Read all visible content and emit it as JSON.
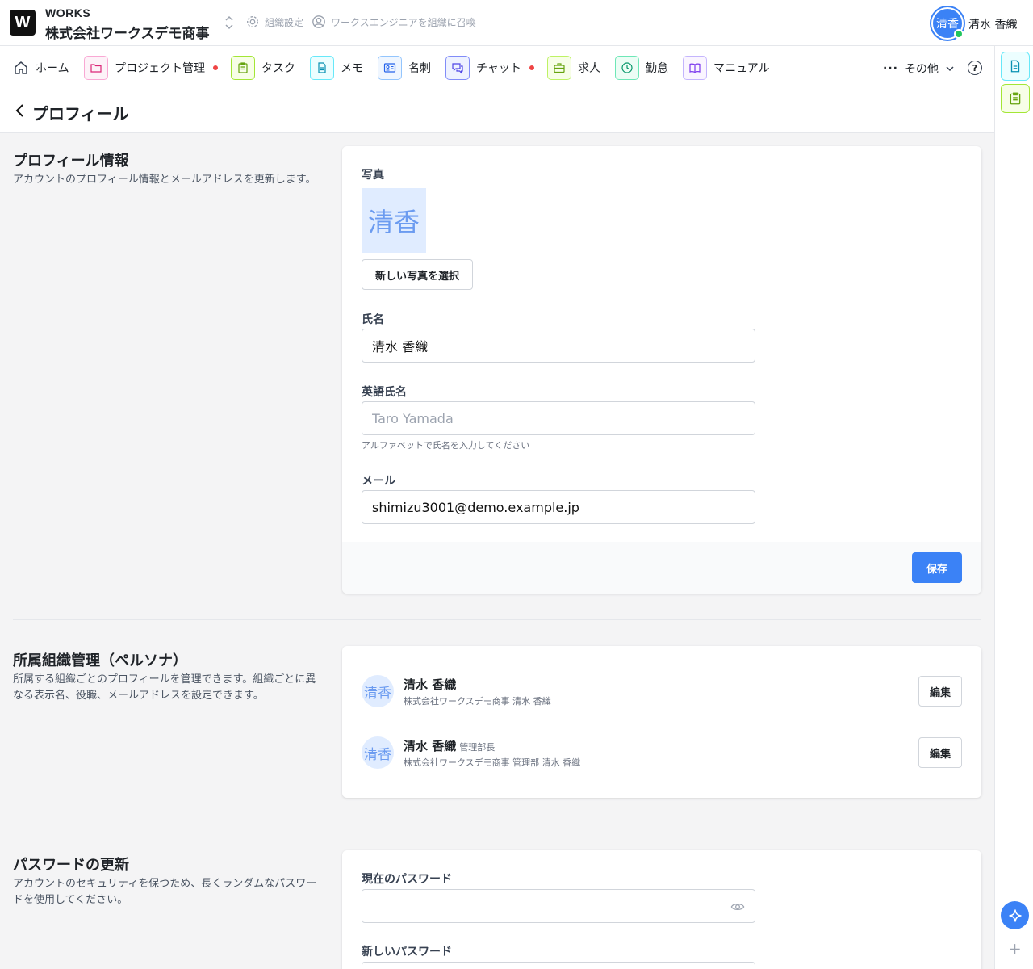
{
  "app": {
    "logo_letter": "W",
    "brand": "WORKS",
    "org_name": "株式会社ワークスデモ商事",
    "org_settings": "組織設定",
    "invite_engineer": "ワークスエンジニアを組織に召喚",
    "user_avatar_text": "清香",
    "user_name": "清水 香織"
  },
  "nav": {
    "items": [
      {
        "label": "ホーム",
        "icon": "home-icon"
      },
      {
        "label": "プロジェクト管理",
        "icon": "folder-icon",
        "badge": true
      },
      {
        "label": "タスク",
        "icon": "clipboard-icon"
      },
      {
        "label": "メモ",
        "icon": "document-icon"
      },
      {
        "label": "名刺",
        "icon": "id-card-icon"
      },
      {
        "label": "チャット",
        "icon": "chat-icon",
        "badge": true
      },
      {
        "label": "求人",
        "icon": "briefcase-icon"
      },
      {
        "label": "勤怠",
        "icon": "clock-icon"
      },
      {
        "label": "マニュアル",
        "icon": "book-icon"
      }
    ],
    "more_label": "その他",
    "help_label": "?"
  },
  "page": {
    "title": "プロフィール"
  },
  "profile_section": {
    "title": "プロフィール情報",
    "description": "アカウントのプロフィール情報とメールアドレスを更新します。",
    "photo_label": "写真",
    "photo_text": "清香",
    "select_photo_button": "新しい写真を選択",
    "name_label": "氏名",
    "name_value": "清水 香織",
    "english_name_label": "英語氏名",
    "english_name_placeholder": "Taro Yamada",
    "english_name_hint": "アルファベットで氏名を入力してください",
    "email_label": "メール",
    "email_value": "shimizu3001@demo.example.jp",
    "save_button": "保存"
  },
  "persona_section": {
    "title": "所属組織管理（ペルソナ）",
    "description": "所属する組織ごとのプロフィールを管理できます。組織ごとに異なる表示名、役職、メールアドレスを設定できます。",
    "personas": [
      {
        "avatar": "清香",
        "name": "清水 香織",
        "role": "",
        "sub": "株式会社ワークスデモ商事 清水 香織",
        "edit": "編集"
      },
      {
        "avatar": "清香",
        "name": "清水 香織",
        "role": "管理部長",
        "sub": "株式会社ワークスデモ商事 管理部 清水 香織",
        "edit": "編集"
      }
    ]
  },
  "password_section": {
    "title": "パスワードの更新",
    "description": "アカウントのセキュリティを保つため、長くランダムなパスワードを使用してください。",
    "current_label": "現在のパスワード",
    "new_label": "新しいパスワード"
  },
  "colors": {
    "accent": "#3b82f6",
    "badge": "#ef4444",
    "online": "#22c55e"
  }
}
